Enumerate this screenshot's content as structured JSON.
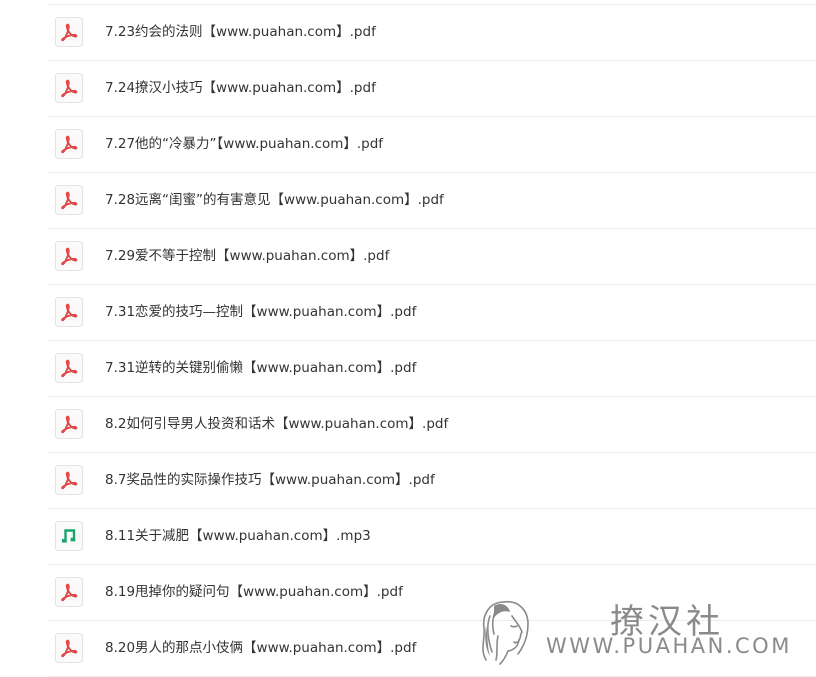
{
  "files": [
    {
      "name": "7.23约会的法则【www.puahan.com】.pdf",
      "icon": "pdf-icon"
    },
    {
      "name": "7.24撩汉小技巧【www.puahan.com】.pdf",
      "icon": "pdf-icon"
    },
    {
      "name": "7.27他的“冷暴力”【www.puahan.com】.pdf",
      "icon": "pdf-icon"
    },
    {
      "name": "7.28远离“闺蜜”的有害意见【www.puahan.com】.pdf",
      "icon": "pdf-icon"
    },
    {
      "name": "7.29爱不等于控制【www.puahan.com】.pdf",
      "icon": "pdf-icon"
    },
    {
      "name": "7.31恋爱的技巧—控制【www.puahan.com】.pdf",
      "icon": "pdf-icon"
    },
    {
      "name": "7.31逆转的关键别偷懒【www.puahan.com】.pdf",
      "icon": "pdf-icon"
    },
    {
      "name": "8.2如何引导男人投资和话术【www.puahan.com】.pdf",
      "icon": "pdf-icon"
    },
    {
      "name": "8.7奖品性的实际操作技巧【www.puahan.com】.pdf",
      "icon": "pdf-icon"
    },
    {
      "name": "8.11关于减肥【www.puahan.com】.mp3",
      "icon": "music-note-icon"
    },
    {
      "name": "8.19甩掉你的疑问句【www.puahan.com】.pdf",
      "icon": "pdf-icon"
    },
    {
      "name": "8.20男人的那点小伎俩【www.puahan.com】.pdf",
      "icon": "pdf-icon"
    }
  ],
  "watermark": {
    "title": "撩汉社",
    "url": "WWW.PUAHAN.COM"
  },
  "colors": {
    "pdf_icon": "#e0484a",
    "audio_icon": "#1aa56a",
    "text": "#333333",
    "divider": "#ececec",
    "watermark": "#8a8a8a"
  }
}
